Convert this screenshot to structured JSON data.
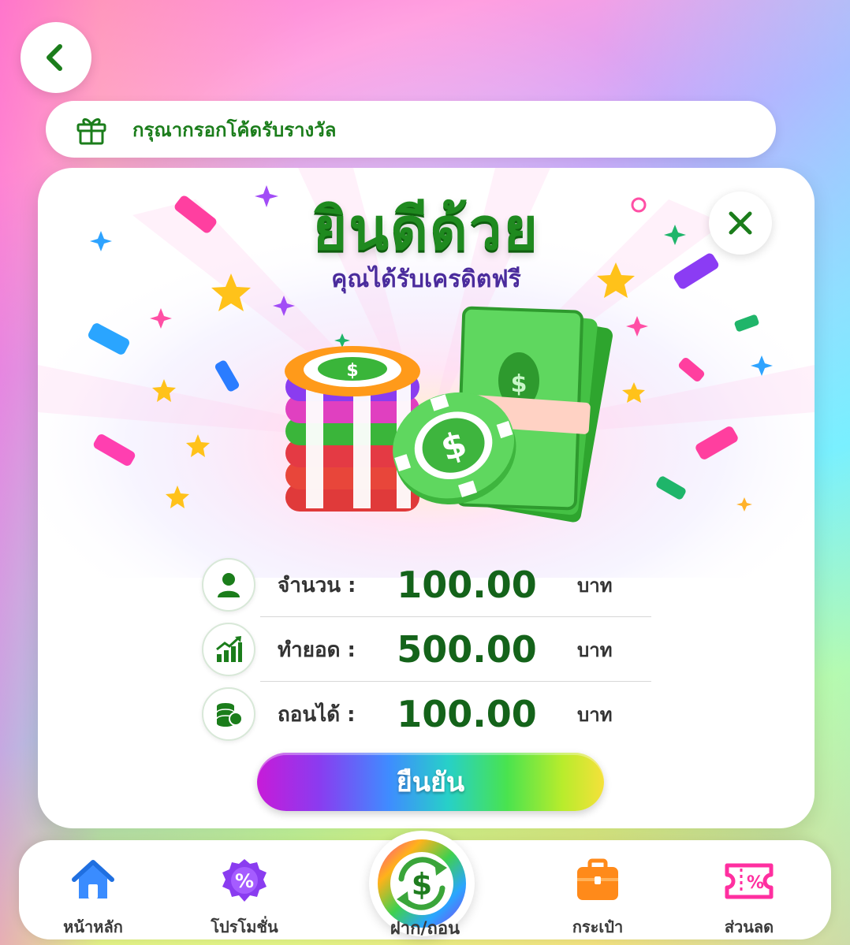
{
  "header": {
    "back_icon": "chevron-left-icon"
  },
  "promo": {
    "icon": "gift-icon",
    "placeholder": "กรุณากรอกโค้ดรับรางวัล"
  },
  "dialog": {
    "title": "ยินดีด้วย",
    "subtitle": "คุณได้รับเครดิตฟรี",
    "close_icon": "close-icon",
    "rows": [
      {
        "icon": "user-icon",
        "label": "จำนวน :",
        "value": "100.00",
        "unit": "บาท"
      },
      {
        "icon": "chart-growth-icon",
        "label": "ทำยอด :",
        "value": "500.00",
        "unit": "บาท"
      },
      {
        "icon": "coins-stack-icon",
        "label": "ถอนได้ :",
        "value": "100.00",
        "unit": "บาท"
      }
    ],
    "confirm_label": "ยืนยัน"
  },
  "bottom_nav": {
    "items": [
      {
        "label": "หน้าหลัก",
        "icon": "home-icon"
      },
      {
        "label": "โปรโมชั่น",
        "icon": "promotion-badge-icon"
      },
      {
        "label": "ฝาก/ถอน",
        "icon": "deposit-withdraw-icon"
      },
      {
        "label": "กระเป๋า",
        "icon": "wallet-bag-icon"
      },
      {
        "label": "ส่วนลด",
        "icon": "discount-ticket-icon"
      }
    ]
  },
  "colors": {
    "brand_green": "#1f8a1f",
    "value_green": "#14631a",
    "subtitle_purple": "#4a2b9c"
  }
}
